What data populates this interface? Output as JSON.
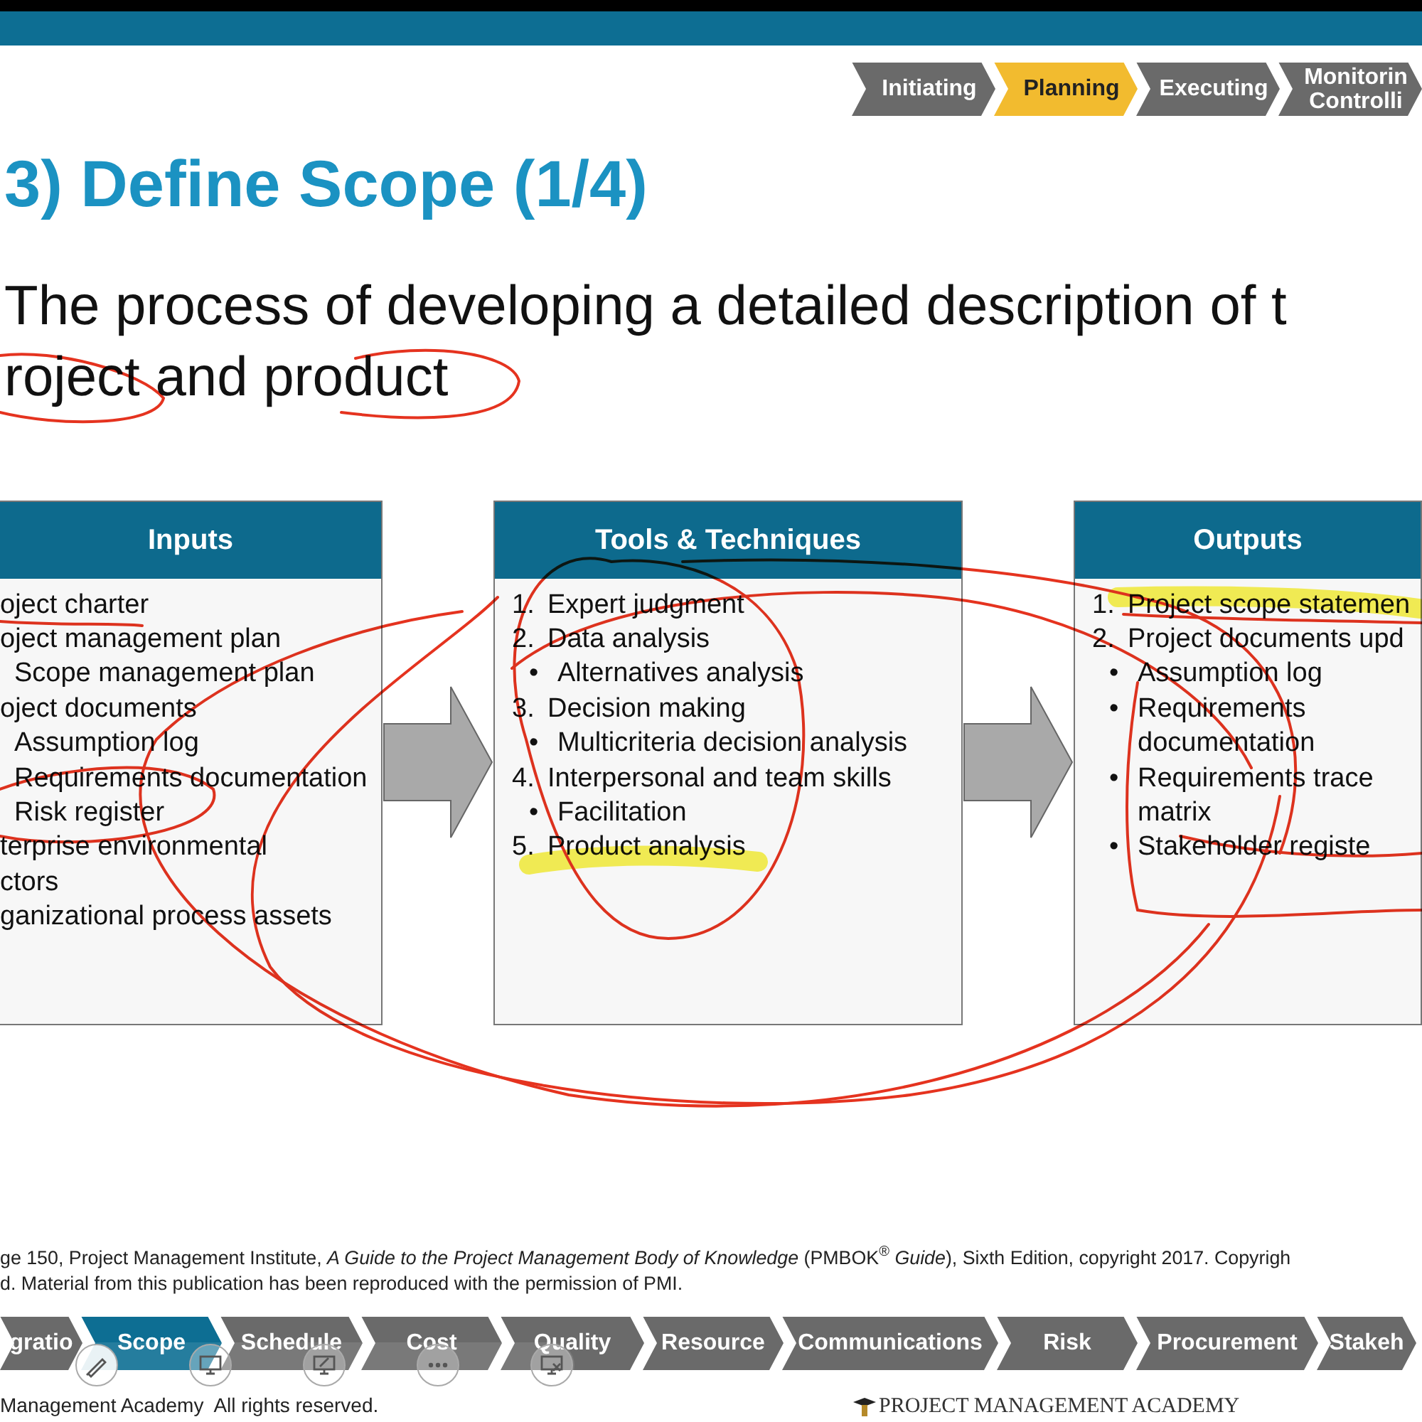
{
  "phases": [
    {
      "lines": [
        "Initiating"
      ],
      "selected": false
    },
    {
      "lines": [
        "Planning"
      ],
      "selected": true
    },
    {
      "lines": [
        "Executing"
      ],
      "selected": false
    },
    {
      "lines": [
        "Monitorin",
        "Controlli"
      ],
      "selected": false
    }
  ],
  "title": "3) Define Scope (1/4)",
  "description": [
    "The process of developing a detailed description of t",
    "roject and product"
  ],
  "inputs": {
    "title": "Inputs",
    "items": [
      {
        "text": "oject charter"
      },
      {
        "text": "oject management plan",
        "children": [
          {
            "text": "Scope management plan"
          }
        ]
      },
      {
        "text": "oject documents",
        "children": [
          {
            "text": "Assumption log"
          },
          {
            "text": "Requirements documentation"
          },
          {
            "text": "Risk register"
          }
        ]
      },
      {
        "lines": [
          "terprise environmental",
          "ctors"
        ]
      },
      {
        "text": "ganizational process assets"
      }
    ]
  },
  "tools": {
    "title": "Tools & Techniques",
    "items": [
      {
        "number": "1.",
        "text": "Expert judgment"
      },
      {
        "number": "2.",
        "text": "Data analysis",
        "children": [
          {
            "bullet": "•",
            "text": "Alternatives analysis"
          }
        ]
      },
      {
        "number": "3.",
        "text": "Decision making",
        "children": [
          {
            "bullet": "•",
            "text": "Multicriteria decision analysis"
          }
        ]
      },
      {
        "number": "4.",
        "text": "Interpersonal and team skills",
        "children": [
          {
            "bullet": "•",
            "text": "Facilitation"
          }
        ]
      },
      {
        "number": "5.",
        "text": "Product analysis"
      }
    ]
  },
  "outputs": {
    "title": "Outputs",
    "items": [
      {
        "number": "1.",
        "text": "Project scope statemen"
      },
      {
        "number": "2.",
        "text": "Project documents upd",
        "children": [
          {
            "bullet": "•",
            "text": "Assumption log"
          },
          {
            "bullet": "•",
            "text": "Requirements documentation"
          },
          {
            "bullet": "•",
            "lines": [
              "Requirements trace",
              "matrix"
            ]
          },
          {
            "bullet": "•",
            "text": "Stakeholder registe"
          }
        ]
      }
    ]
  },
  "citation": [
    "ge 150, Project Management Institute, *A Guide to the Project Management Body of Knowledge* (PMBOK$^{®}$ *Guide*), Sixth Edition, copyright 2017. Copyrigh",
    "d. Material from this publication has been reproduced with the permission of PMI."
  ],
  "knowledge_areas": [
    {
      "label": "gratio",
      "selected": false
    },
    {
      "label": "Scope",
      "selected": true
    },
    {
      "label": "Schedule",
      "selected": false
    },
    {
      "label": "Cost",
      "selected": false
    },
    {
      "label": "Quality",
      "selected": false
    },
    {
      "label": "Resource",
      "selected": false
    },
    {
      "label": "Communications",
      "selected": false
    },
    {
      "label": "Risk",
      "selected": false
    },
    {
      "label": "Procurement",
      "selected": false
    },
    {
      "label": "Stakeh",
      "selected": false
    }
  ],
  "copyright": "Management Academy  All rights reserved.",
  "logo": "PROJECT MANAGEMENT ACADEMY"
}
